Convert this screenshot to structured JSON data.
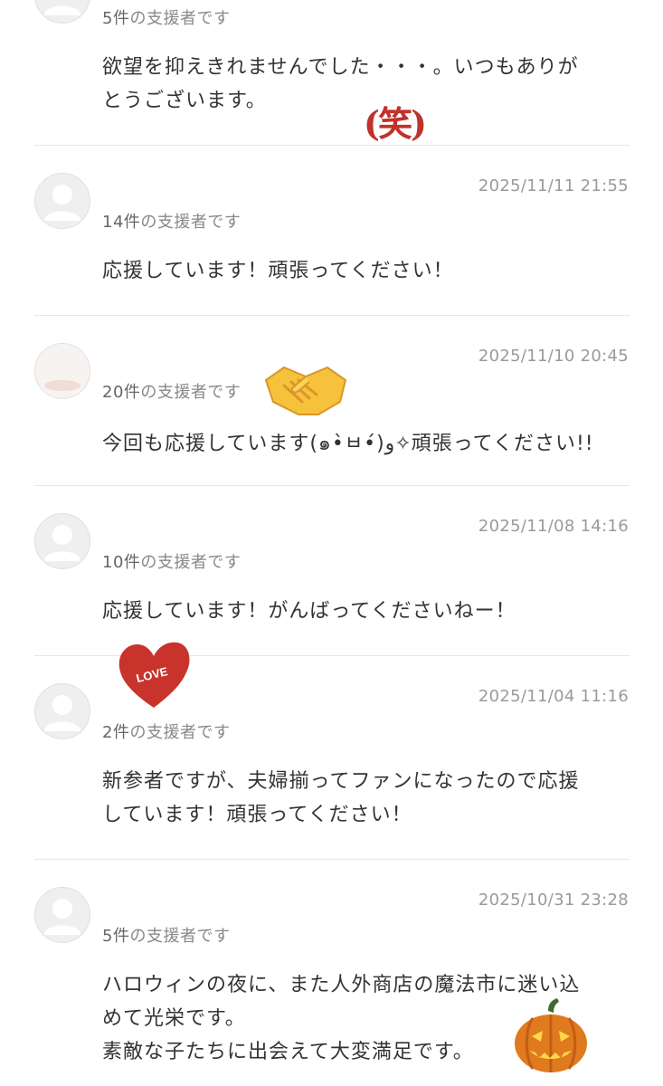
{
  "comments": [
    {
      "username": "",
      "support_count": "5件",
      "support_suffix": "の支援者です",
      "date": "",
      "message_lines": [
        "欲望を抑えきれませんでした・・・。いつもありが",
        "とうございます。"
      ]
    },
    {
      "username": "",
      "support_count": "14件",
      "support_suffix": "の支援者です",
      "date": "2025/11/11 21:55",
      "message_lines": [
        "応援しています！頑張ってください！"
      ]
    },
    {
      "username": "",
      "support_count": "20件",
      "support_suffix": "の支援者です",
      "date": "2025/11/10 20:45",
      "message_lines": [
        "今回も応援しています(๑•̀ㅂ•́)و✧頑張ってください!!"
      ]
    },
    {
      "username": "",
      "support_count": "10件",
      "support_suffix": "の支援者です",
      "date": "2025/11/08 14:16",
      "message_lines": [
        "応援しています！がんばってくださいねー！"
      ]
    },
    {
      "username": "",
      "support_count": "2件",
      "support_suffix": "の支援者です",
      "date": "2025/11/04 11:16",
      "message_lines": [
        "新参者ですが、夫婦揃ってファンになったので応援",
        "しています！頑張ってください！"
      ]
    },
    {
      "username": "",
      "support_count": "5件",
      "support_suffix": "の支援者です",
      "date": "2025/10/31 23:28",
      "message_lines": [
        "ハロウィンの夜に、また人外商店の魔法市に迷い込",
        "めて光栄です。",
        "素敵な子たちに出会えて大変満足です。"
      ]
    }
  ],
  "stickers": {
    "warai_text": "(笑)",
    "love_text": "LOVE",
    "handshake_icon": "handshake-emoji",
    "pumpkin_icon": "jack-o-lantern"
  },
  "colors": {
    "divider": "#e6e6e6",
    "date": "#9a9a9a",
    "count": "#888888",
    "heart": "#c8342c",
    "warai": "#c0322b"
  }
}
